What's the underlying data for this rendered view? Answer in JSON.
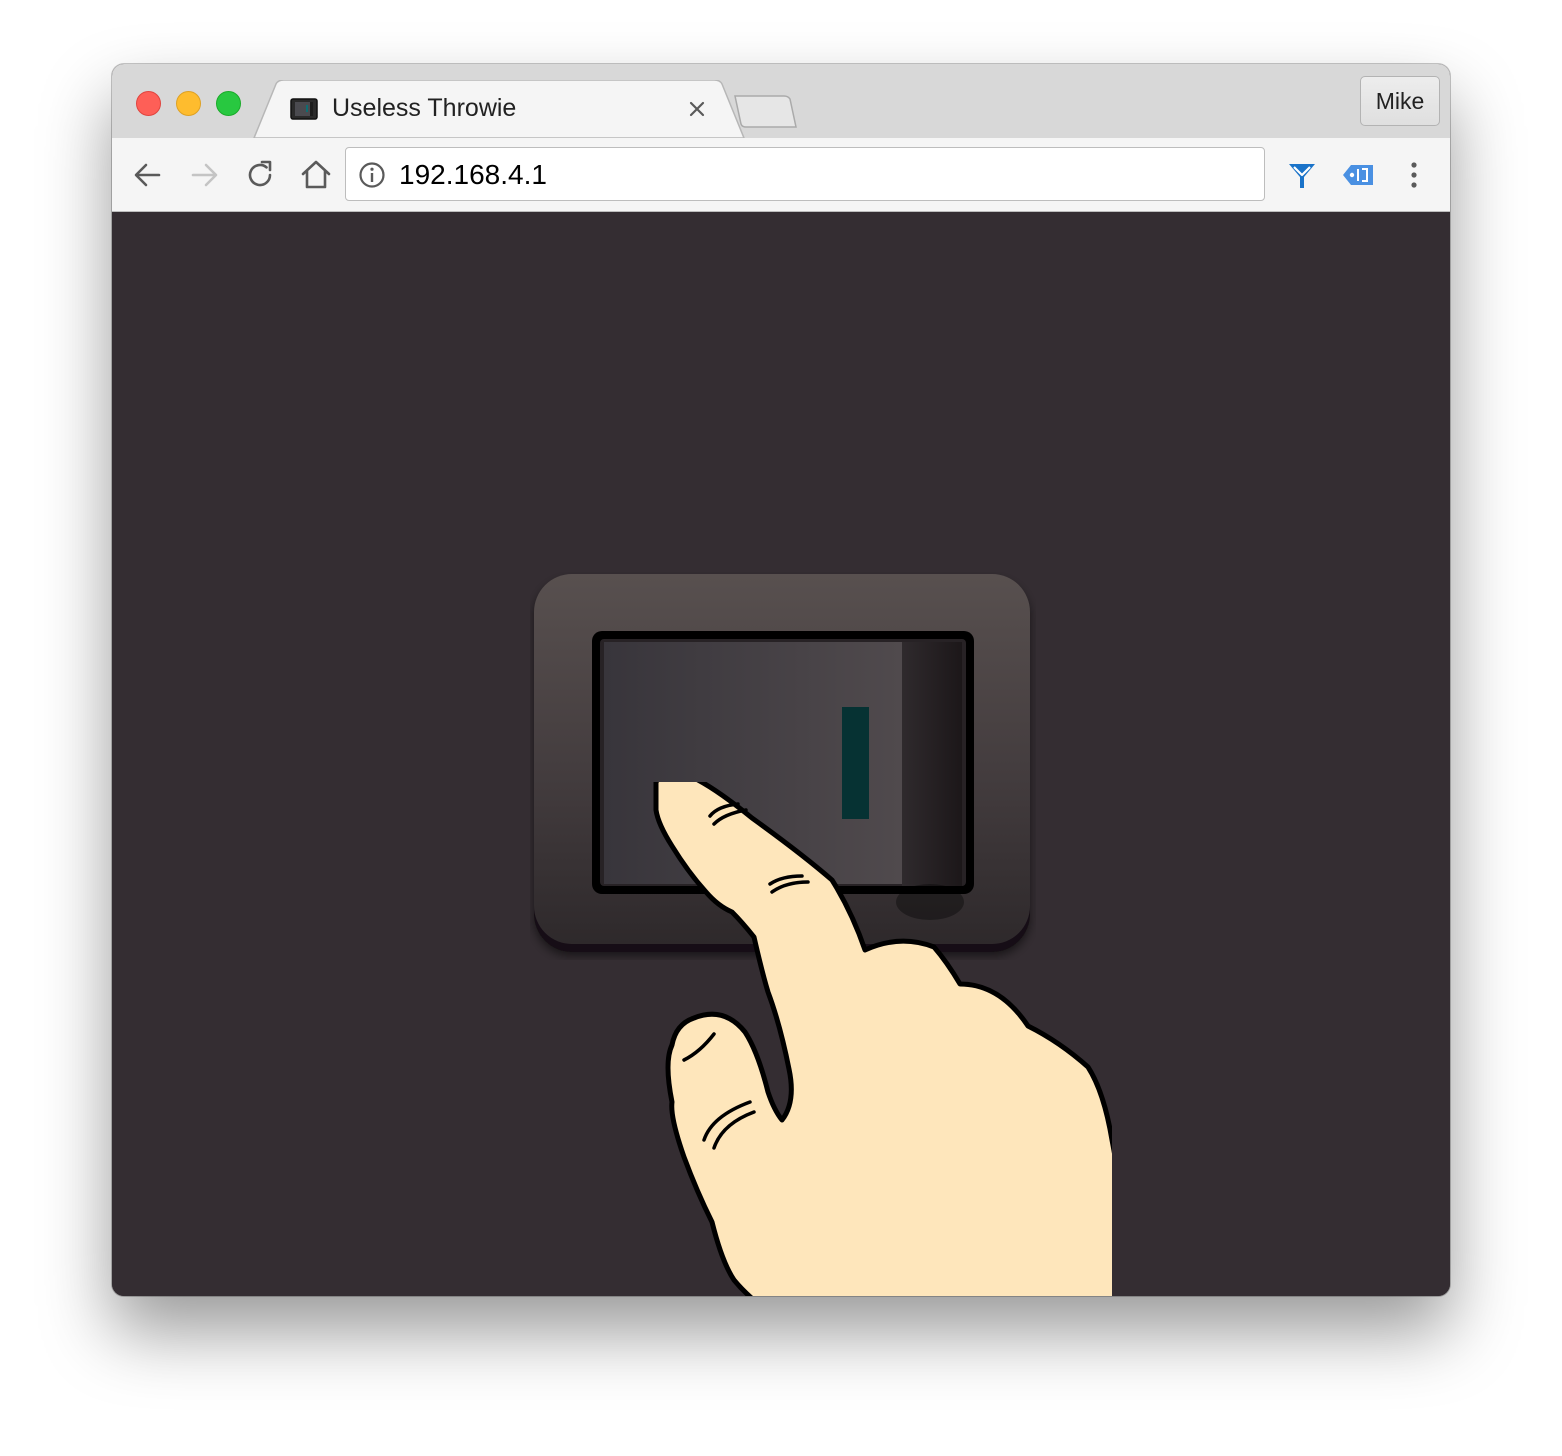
{
  "tab": {
    "title": "Useless Throwie",
    "favicon": "switch-favicon-icon",
    "close_icon": "close-icon"
  },
  "new_tab_icon": "new-tab-icon",
  "profile": {
    "label": "Mike"
  },
  "toolbar": {
    "back_icon": "arrow-left-icon",
    "forward_icon": "arrow-right-icon",
    "forward_enabled": false,
    "reload_icon": "reload-icon",
    "home_icon": "home-icon",
    "extensions": [
      "y-funnel-extension-icon",
      "tag-extension-icon"
    ],
    "menu_icon": "more-vertical-icon"
  },
  "omnibox": {
    "url": "192.168.4.1",
    "security_icon": "info-icon"
  },
  "page": {
    "background": "#342d32",
    "switch_state": "off",
    "indicator_color": "#063233",
    "hand_color": "#fee6bb"
  }
}
